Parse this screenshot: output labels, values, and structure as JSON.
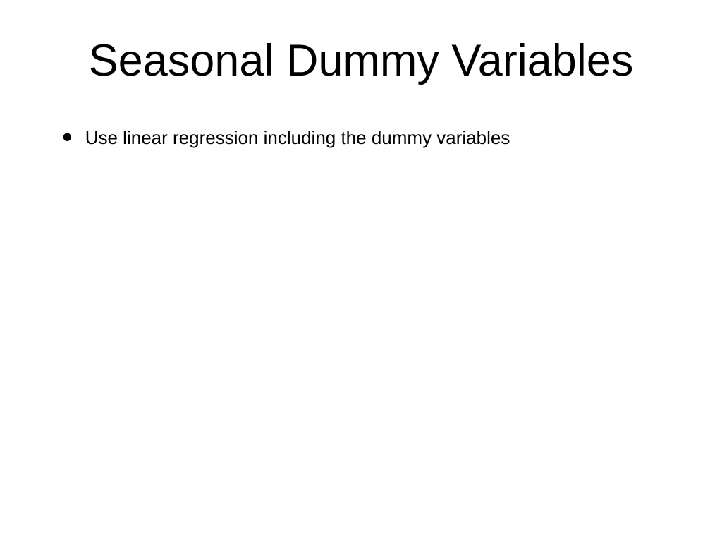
{
  "slide": {
    "title": "Seasonal Dummy Variables",
    "bullets": [
      {
        "text": "Use linear regression including the dummy variables"
      }
    ]
  }
}
